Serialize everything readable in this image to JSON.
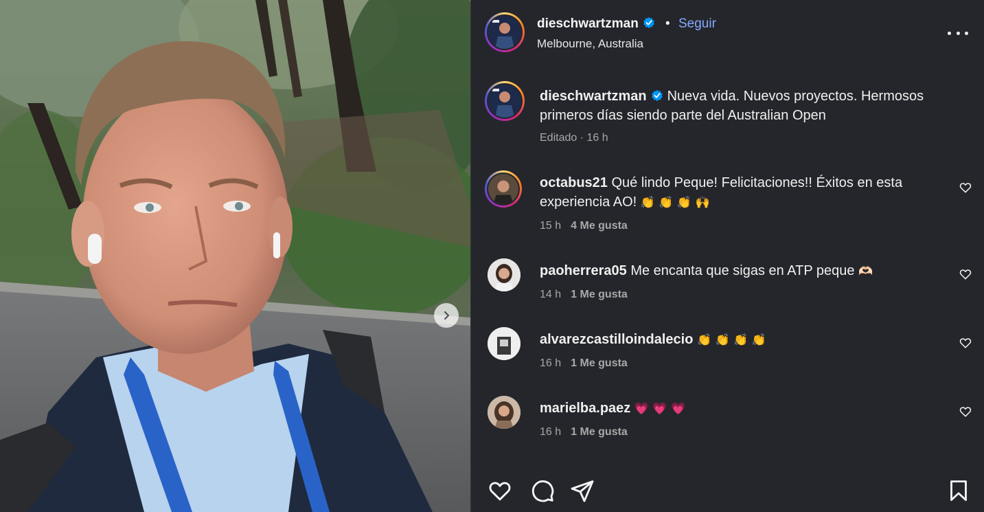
{
  "post": {
    "username": "dieschwartzman",
    "follow_label": "Seguir",
    "separator": "•",
    "location": "Melbourne, Australia",
    "caption": "Nueva vida. Nuevos proyectos. Hermosos primeros días siendo parte del Australian Open",
    "caption_meta": "Editado · 16 h"
  },
  "comments": [
    {
      "username": "octabus21",
      "text": "Qué lindo Peque! Felicitaciones!! Éxitos en esta experiencia AO!",
      "emoji": "👏 👏 👏 🙌",
      "time": "15 h",
      "likes": "4 Me gusta"
    },
    {
      "username": "paoherrera05",
      "text": "Me encanta que sigas en ATP peque",
      "emoji": "🫶🏻",
      "time": "14 h",
      "likes": "1 Me gusta"
    },
    {
      "username": "alvarezcastilloindalecio",
      "text": "",
      "emoji": "👏 👏 👏 👏",
      "time": "16 h",
      "likes": "1 Me gusta"
    },
    {
      "username": "marielba.paez",
      "text": "",
      "emoji": "💗 💗 💗",
      "time": "16 h",
      "likes": "1 Me gusta"
    }
  ],
  "icons": {
    "verified": "verified-badge-icon",
    "more": "more-options-icon",
    "like": "heart-icon",
    "comment": "comment-icon",
    "share": "share-icon",
    "save": "bookmark-icon",
    "next": "chevron-right-icon"
  },
  "colors": {
    "panel_bg": "#25262b",
    "link_blue": "#85a9ff",
    "verified_blue": "#0095f6",
    "muted_text": "#a8a8a8"
  }
}
